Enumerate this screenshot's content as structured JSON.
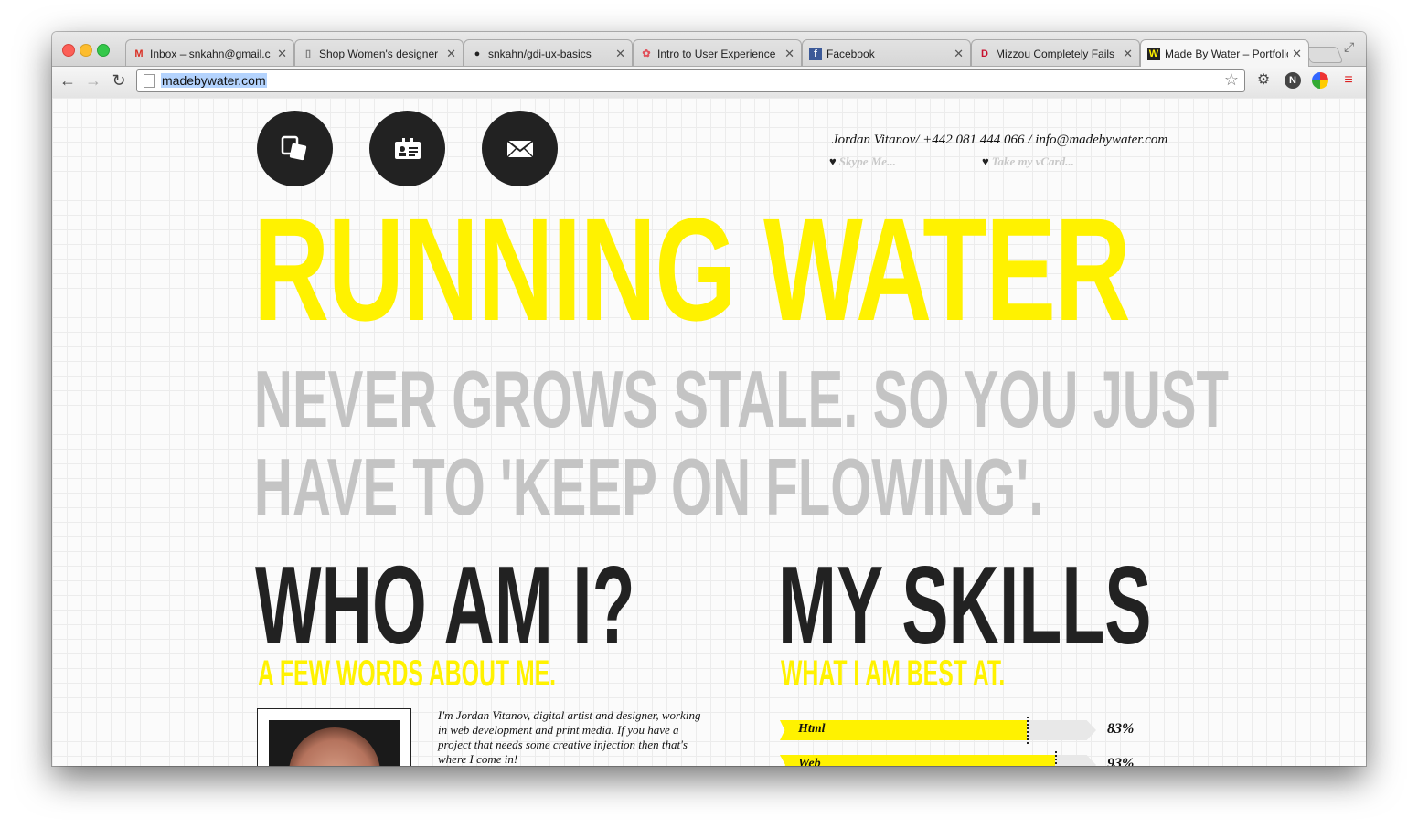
{
  "browser": {
    "tabs": [
      {
        "label": "Inbox – snkahn@gmail.c",
        "icon": "gmail-icon",
        "favicon": "M",
        "favicon_color": "#d93025"
      },
      {
        "label": "Shop Women's designer",
        "icon": "page-icon",
        "favicon": "▯",
        "favicon_color": "#777777"
      },
      {
        "label": "snkahn/gdi-ux-basics",
        "icon": "github-icon",
        "favicon": "●",
        "favicon_color": "#222222"
      },
      {
        "label": "Intro to User Experience",
        "icon": "girl-develop-it-icon",
        "favicon": "✿",
        "favicon_color": "#e0505a"
      },
      {
        "label": "Facebook",
        "icon": "facebook-icon",
        "favicon": "f",
        "favicon_color": "#3b5998"
      },
      {
        "label": "Mizzou Completely Fails",
        "icon": "deadspin-icon",
        "favicon": "D",
        "favicon_color": "#c8102e"
      },
      {
        "label": "Made By Water – Portfolio",
        "icon": "madebywater-icon",
        "favicon": "W",
        "favicon_color": "#fff200"
      }
    ],
    "url": "madebywater.com"
  },
  "header": {
    "contact": "Jordan Vitanov/ +442 081 444 066 / info@madebywater.com",
    "skype_link": "Skype Me...",
    "vcard_link": "Take my vCard..."
  },
  "hero": {
    "headline": "RUNNING WATER",
    "tagline_line1": "NEVER GROWS STALE. SO YOU JUST",
    "tagline_line2": "HAVE TO 'KEEP ON FLOWING'."
  },
  "about": {
    "title": "WHO AM I?",
    "subtitle": "A FEW WORDS ABOUT ME.",
    "bio": "I'm Jordan Vitanov, digital artist and designer, working in web development and print media. If you have a project that needs some creative injection then that's where I come in!"
  },
  "skills": {
    "title": "MY SKILLS",
    "subtitle": "WHAT I AM BEST AT.",
    "items": [
      {
        "name": "Html",
        "percent_label": "83%",
        "value": 0.78
      },
      {
        "name": "Web Design",
        "percent_label": "93%",
        "value": 0.87
      }
    ]
  },
  "colors": {
    "accent_yellow": "#fff200",
    "dark": "#222222",
    "gray": "#c4c4c4"
  }
}
